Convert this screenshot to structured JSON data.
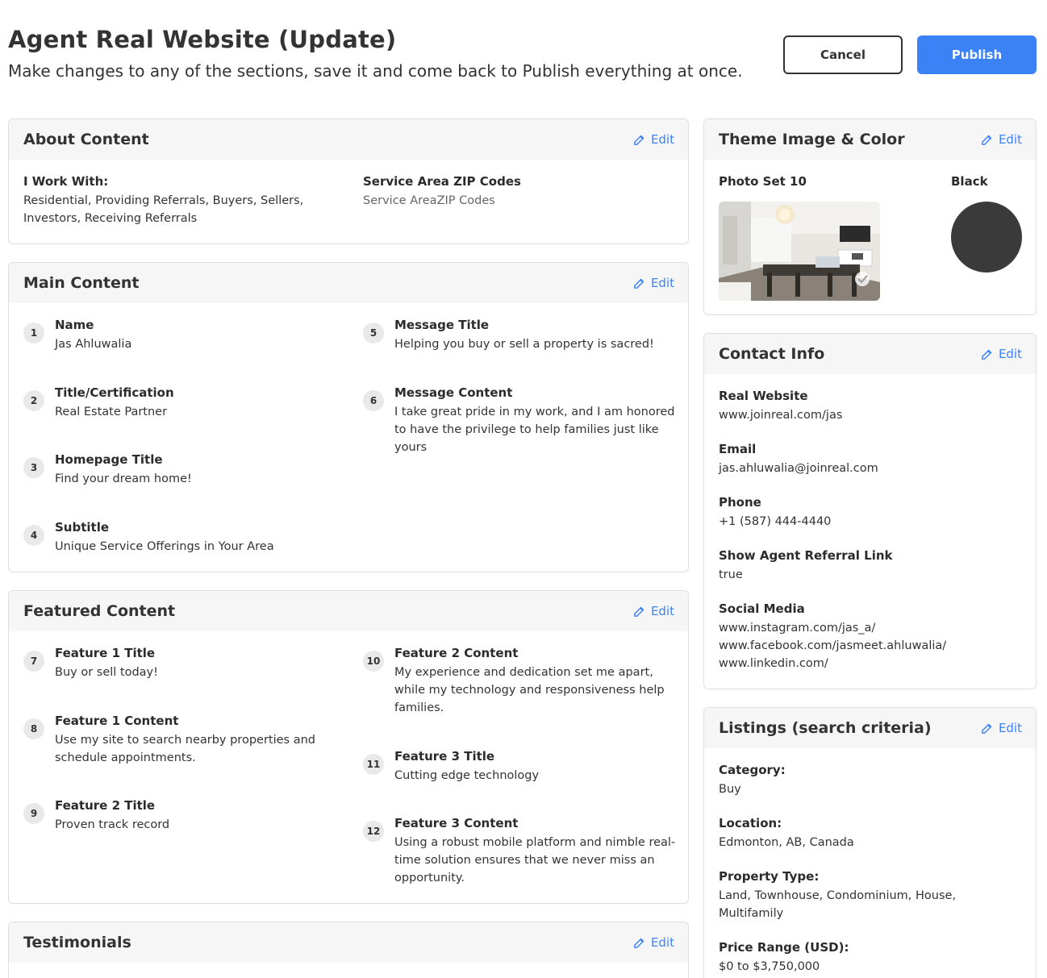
{
  "header": {
    "title": "Agent Real Website (Update)",
    "subtitle": "Make changes to any of the sections, save it and come back to Publish everything at once.",
    "cancel_label": "Cancel",
    "publish_label": "Publish"
  },
  "edit_label": "Edit",
  "about": {
    "title": "About Content",
    "work_label": "I Work With:",
    "work_value": "Residential, Providing Referrals, Buyers, Sellers, Investors, Receiving Referrals",
    "zip_label": "Service Area ZIP Codes",
    "zip_value": "Service AreaZIP Codes"
  },
  "main": {
    "title": "Main Content",
    "items": [
      {
        "num": "1",
        "label": "Name",
        "value": "Jas Ahluwalia"
      },
      {
        "num": "2",
        "label": "Title/Certification",
        "value": "Real Estate Partner"
      },
      {
        "num": "3",
        "label": "Homepage Title",
        "value": "Find your dream home!"
      },
      {
        "num": "4",
        "label": "Subtitle",
        "value": "Unique Service Offerings in Your Area"
      },
      {
        "num": "5",
        "label": "Message Title",
        "value": "Helping you buy or sell a property is sacred!"
      },
      {
        "num": "6",
        "label": "Message Content",
        "value": "I take great pride in my work, and I am honored to have the privilege to help families just like yours"
      }
    ]
  },
  "featured": {
    "title": "Featured Content",
    "items": [
      {
        "num": "7",
        "label": "Feature 1 Title",
        "value": "Buy or sell today!"
      },
      {
        "num": "8",
        "label": "Feature 1 Content",
        "value": "Use my site to search nearby properties and schedule appointments."
      },
      {
        "num": "9",
        "label": "Feature 2 Title",
        "value": "Proven track record"
      },
      {
        "num": "10",
        "label": "Feature 2 Content",
        "value": "My experience and dedication set me apart, while my technology and responsiveness help families."
      },
      {
        "num": "11",
        "label": "Feature 3 Title",
        "value": "Cutting edge technology"
      },
      {
        "num": "12",
        "label": "Feature 3 Content",
        "value": "Using a robust mobile platform and nimble real-time solution ensures that we never miss an opportunity."
      }
    ]
  },
  "testimonials": {
    "title": "Testimonials"
  },
  "theme": {
    "title": "Theme Image & Color",
    "photo_label": "Photo Set 10",
    "color_label": "Black",
    "color_hex": "#3a3a3a"
  },
  "contact": {
    "title": "Contact Info",
    "fields": [
      {
        "label": "Real Website",
        "value": "www.joinreal.com/jas"
      },
      {
        "label": "Email",
        "value": "jas.ahluwalia@joinreal.com"
      },
      {
        "label": "Phone",
        "value": "+1 (587) 444-4440"
      },
      {
        "label": "Show Agent Referral Link",
        "value": "true"
      }
    ],
    "social_label": "Social Media",
    "social": [
      "www.instagram.com/jas_a/",
      "www.facebook.com/jasmeet.ahluwalia/",
      "www.linkedin.com/"
    ]
  },
  "listings": {
    "title": "Listings (search criteria)",
    "fields": [
      {
        "label": "Category:",
        "value": "Buy"
      },
      {
        "label": "Location:",
        "value": "Edmonton, AB, Canada"
      },
      {
        "label": "Property Type:",
        "value": "Land, Townhouse, Condominium, House, Multifamily"
      },
      {
        "label": "Price Range (USD):",
        "value": "$0 to $3,750,000"
      }
    ]
  },
  "colors": {
    "accent": "#3b82f6",
    "header_bg": "#f6f6f6",
    "badge_bg": "#e9e9e9"
  }
}
